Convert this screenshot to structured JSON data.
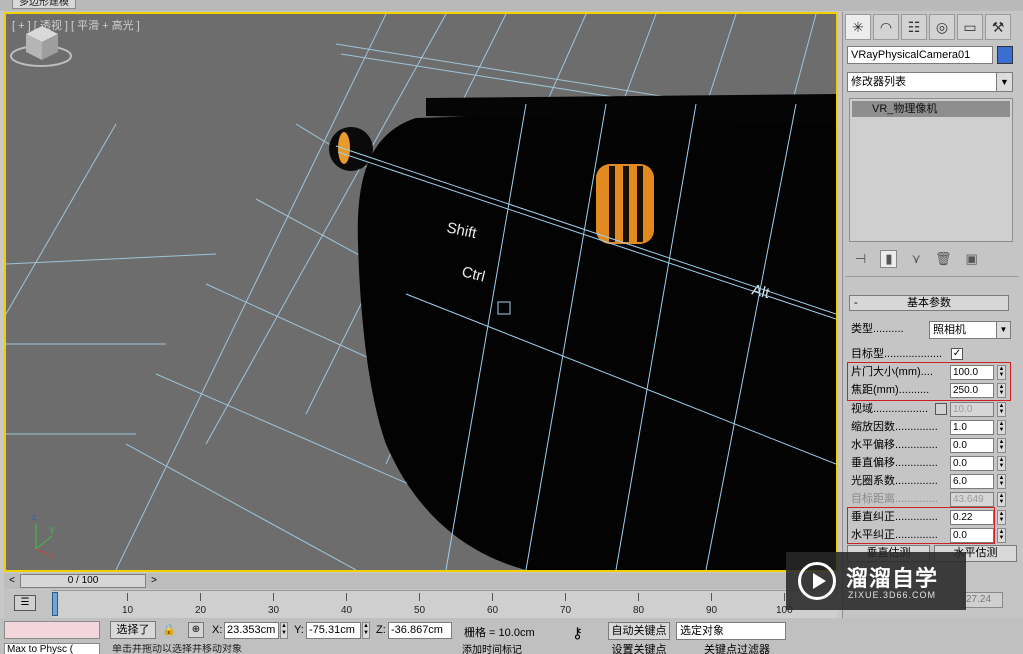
{
  "window": {
    "tab_title": "多边形建模"
  },
  "viewport": {
    "label": "[ + ] [ 透视 ] [ 平滑 + 高光 ]",
    "keys": [
      "Shift",
      "Ctrl",
      "Alt"
    ]
  },
  "command_panel": {
    "tabs": [
      {
        "icon": "create-icon",
        "glyph": "✳"
      },
      {
        "icon": "modify-icon",
        "glyph": "◠"
      },
      {
        "icon": "hierarchy-icon",
        "glyph": "☷"
      },
      {
        "icon": "motion-icon",
        "glyph": "◎"
      },
      {
        "icon": "display-icon",
        "glyph": "▭"
      },
      {
        "icon": "utilities-icon",
        "glyph": "⚒"
      }
    ],
    "object_name": "VRayPhysicalCamera01",
    "object_color": "#3a6fd1",
    "modifier_list": "修改器列表",
    "stack_item": "VR_物理像机",
    "rollout_title": "基本参数",
    "type_label": "类型",
    "type_value": "照相机",
    "targeted_label": "目标型",
    "targeted_checked": "✓",
    "params": [
      {
        "label": "片门大小(mm)",
        "value": "100.0"
      },
      {
        "label": "焦距(mm)",
        "value": "250.0"
      },
      {
        "label": "视域",
        "value": "10.0"
      },
      {
        "label": "缩放因数",
        "value": "1.0"
      },
      {
        "label": "水平偏移",
        "value": "0.0"
      },
      {
        "label": "垂直偏移",
        "value": "0.0"
      },
      {
        "label": "光圈系数",
        "value": "6.0"
      },
      {
        "label": "目标距离",
        "value": "43.649"
      },
      {
        "label": "垂直纠正",
        "value": "0.22"
      },
      {
        "label": "水平纠正",
        "value": "0.0"
      }
    ],
    "buttons": [
      "垂直估测",
      "水平估测"
    ],
    "side_value": "27.24"
  },
  "timeline": {
    "slider": "0 / 100",
    "prev": "<",
    "next": ">",
    "ticks": [
      "0",
      "10",
      "20",
      "30",
      "40",
      "50",
      "60",
      "70",
      "80",
      "90",
      "100"
    ]
  },
  "status_bar": {
    "script_text": "Max to Physc (",
    "selection": "选择了",
    "x_label": "X:",
    "x_value": "23.353cm",
    "y_label": "Y:",
    "y_value": "-75.31cm",
    "z_label": "Z:",
    "z_value": "-36.867cm",
    "grid": "栅格 = 10.0cm",
    "prompt": "单击并拖动以选择并移动对象",
    "add_tag": "添加时间标记",
    "auto_key": "自动关键点",
    "set_key": "设置关键点",
    "selected_object": "选定对象",
    "key_filter": "关键点过滤器"
  },
  "watermark": {
    "title": "溜溜自学",
    "subtitle": "ZIXUE.3D66.COM"
  }
}
